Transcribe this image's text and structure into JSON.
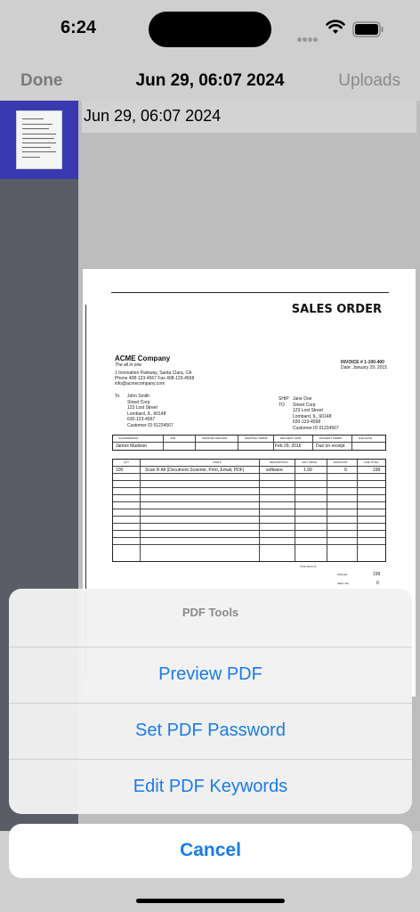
{
  "status_bar": {
    "time": "6:24"
  },
  "nav": {
    "left": "Done",
    "title": "Jun 29, 06:07 2024",
    "right": "Uploads"
  },
  "document": {
    "header_label": "Jun 29, 06:07 2024",
    "page": {
      "title": "SALES ORDER",
      "company_name": "ACME Company",
      "company_tagline": "The all in one",
      "company_address": "1 Innovation Parkway, Santa Clara, CA",
      "company_phone": "Phone 408-123-4567 Fax 408-123-4568",
      "company_email": "info@acmecompany.com",
      "invoice_no": "INVOICE # 1-100-400",
      "invoice_date": "Date: January 29, 2015",
      "to_label": "To",
      "to_block": "John Smith\nStreet Corp\n123 Lost Street\nLombard, IL, 60148\n630-123-4567\nCustomer ID 01234567",
      "ship_label": "SHIP\nTO",
      "ship_block": "Jane Doe\nStreet Corp\n123 Lost Street\nLombard, IL, 60148\n630-123-4568\nCustomer ID 01234567",
      "order_headers": [
        "SALESPERSON",
        "JOB",
        "SHIPPING METHOD",
        "SHIPPING TERMS",
        "DELIVERY DATE",
        "PAYMENT TERMS",
        "DUE DATE"
      ],
      "order_values": [
        "James Madison",
        "",
        "",
        "",
        "Feb 29, 2016",
        "Due on receipt",
        ""
      ],
      "item_headers": [
        "QTY",
        "ITEM #",
        "DESCRIPTION",
        "UNIT PRICE",
        "DISCOUNT",
        "LINE TOTAL"
      ],
      "item_row": [
        "100",
        "Scan R All (Document Scanner, Print, Email, PDF)",
        "software",
        "1.99",
        "0",
        "199"
      ],
      "total_discount_label": "Total discount",
      "subtotal_label": "Subtotal",
      "subtotal_value": "199",
      "sales_tax_label": "Sales Tax",
      "sales_tax_value": "0"
    }
  },
  "action_sheet": {
    "title": "PDF Tools",
    "actions": [
      "Preview PDF",
      "Set PDF Password",
      "Edit PDF Keywords"
    ],
    "cancel": "Cancel"
  },
  "colors": {
    "accent": "#1a7ce8",
    "thumbnail_selected": "#3a3ab0",
    "sidebar": "#5b5d66"
  },
  "icons": [
    "wifi-icon",
    "battery-icon",
    "signal-icon"
  ]
}
